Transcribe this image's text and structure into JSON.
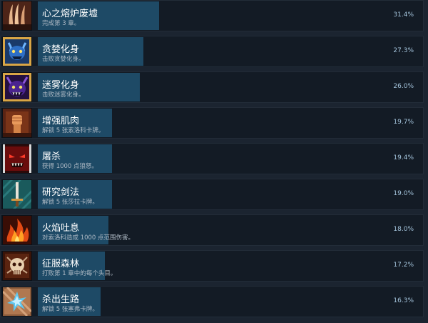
{
  "achievements": [
    {
      "title": "心之熔炉废墟",
      "description": "完成第 3 章。",
      "percent": "31.4%",
      "percent_value": 31.4,
      "icon": "claw-icon"
    },
    {
      "title": "贪婪化身",
      "description": "击败贪婪化身。",
      "percent": "27.3%",
      "percent_value": 27.3,
      "icon": "blue-demon-icon"
    },
    {
      "title": "迷雾化身",
      "description": "击败迷雾化身。",
      "percent": "26.0%",
      "percent_value": 26.0,
      "icon": "purple-demon-icon"
    },
    {
      "title": "增强肌肉",
      "description": "解锁 5 张索洛科卡牌。",
      "percent": "19.7%",
      "percent_value": 19.7,
      "icon": "fist-icon"
    },
    {
      "title": "屠杀",
      "description": "获得 1000 点狼怒。",
      "percent": "19.4%",
      "percent_value": 19.4,
      "icon": "red-eyes-icon"
    },
    {
      "title": "研究剑法",
      "description": "解锁 5 张莎拉卡牌。",
      "percent": "19.0%",
      "percent_value": 19.0,
      "icon": "sword-icon"
    },
    {
      "title": "火焰吐息",
      "description": "对索洛科造成 1000 点范围伤害。",
      "percent": "18.0%",
      "percent_value": 18.0,
      "icon": "flame-icon"
    },
    {
      "title": "征服森林",
      "description": "打败第 1 章中的每个头目。",
      "percent": "17.2%",
      "percent_value": 17.2,
      "icon": "skull-icon"
    },
    {
      "title": "杀出生路",
      "description": "解锁 5 张塞弗卡牌。",
      "percent": "16.3%",
      "percent_value": 16.3,
      "icon": "shatter-icon"
    }
  ],
  "colors": {
    "background": "#1b2430",
    "row": "#131b25",
    "bar": "#1e4a66",
    "percent_text": "#a4c4dc"
  }
}
